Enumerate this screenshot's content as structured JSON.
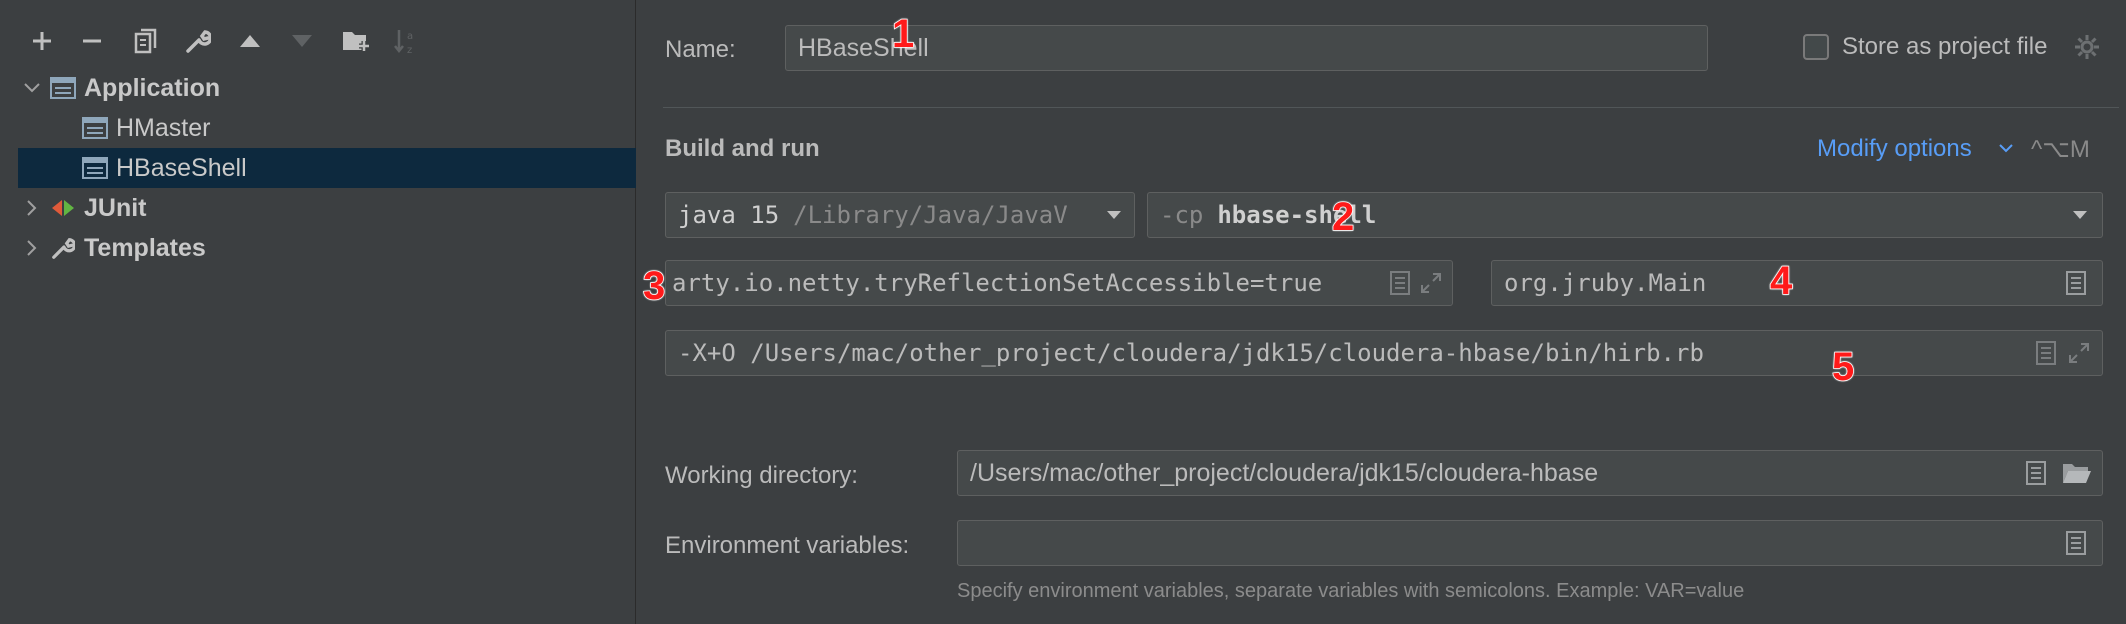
{
  "toolbar": {
    "icons": [
      "add-icon",
      "remove-icon",
      "copy-icon",
      "wrench-icon",
      "move-up-icon",
      "move-down-icon",
      "new-folder-icon",
      "sort-icon"
    ]
  },
  "tree": {
    "items": [
      {
        "label": "Application",
        "icon": "application-config-icon",
        "expanded": true
      },
      {
        "label": "HMaster",
        "icon": "application-config-icon"
      },
      {
        "label": "HBaseShell",
        "icon": "application-config-icon",
        "selected": true
      },
      {
        "label": "JUnit",
        "icon": "junit-icon",
        "expanded": false
      },
      {
        "label": "Templates",
        "icon": "wrench-icon",
        "expanded": false
      }
    ]
  },
  "form": {
    "name_label": "Name:",
    "name_value": "HBaseShell",
    "store_as_project_file": "Store as project file",
    "build_and_run": "Build and run",
    "modify_options": "Modify options",
    "modify_options_shortcut": "^⌥M",
    "jre_version": "java 15",
    "jre_path": "/Library/Java/JavaV",
    "classpath_flag": "-cp",
    "classpath_value": "hbase-shell",
    "vm_options": "arty.io.netty.tryReflectionSetAccessible=true",
    "main_class": "org.jruby.Main",
    "program_args": "-X+O /Users/mac/other_project/cloudera/jdk15/cloudera-hbase/bin/hirb.rb",
    "working_dir_label": "Working directory:",
    "working_dir_value": "/Users/mac/other_project/cloudera/jdk15/cloudera-hbase",
    "env_vars_label": "Environment variables:",
    "env_vars_value": "",
    "env_vars_hint": "Specify environment variables, separate variables with semicolons. Example: VAR=value"
  },
  "annotations": [
    "1",
    "2",
    "3",
    "4",
    "5"
  ],
  "colors": {
    "background": "#3c3f41",
    "selection": "#0d293e",
    "link": "#589df6",
    "annotation": "#ff1a1a"
  }
}
